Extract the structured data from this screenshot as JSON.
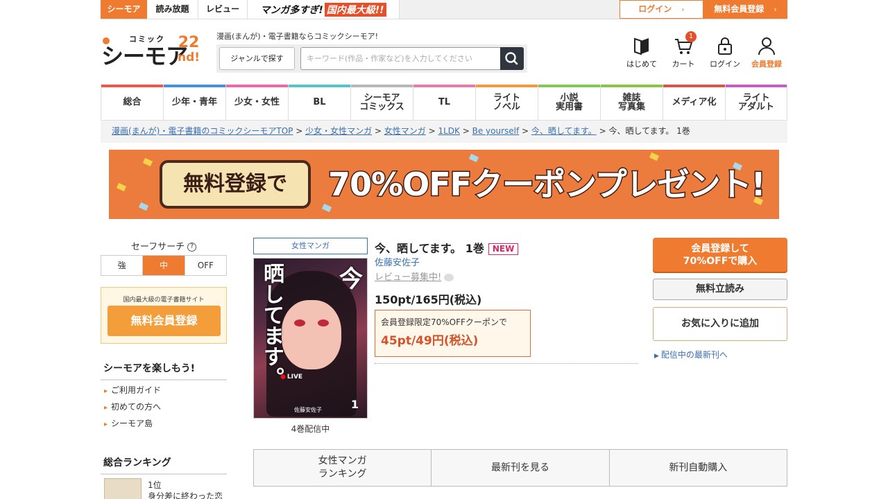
{
  "topbar": {
    "tabs": [
      "シーモア",
      "読み放題",
      "レビュー"
    ],
    "promo_a": "マンガ多すぎ!",
    "promo_b": "国内最大級!!",
    "login": "ログイン",
    "register": "無料会員登録"
  },
  "header": {
    "logo_small": "コミック",
    "logo_big": "シーモア",
    "logo_num": "22",
    "logo_nd": "nd!",
    "tagline": "漫画(まんが)・電子書籍ならコミックシーモア!",
    "genre_button": "ジャンルで探す",
    "search_placeholder": "キーワード(作品・作家など)を入力してください",
    "icons": [
      {
        "label": "はじめて",
        "icon": "book-icon"
      },
      {
        "label": "カート",
        "icon": "cart-icon",
        "badge": "1"
      },
      {
        "label": "ログイン",
        "icon": "lock-icon"
      },
      {
        "label": "会員登録",
        "icon": "user-icon"
      }
    ]
  },
  "gnav": {
    "items": [
      {
        "label": "総合",
        "color": "#e8594f"
      },
      {
        "label": "少年・青年",
        "color": "#4a90d9"
      },
      {
        "label": "少女・女性",
        "color": "#e86aa6"
      },
      {
        "label": "BL",
        "color": "#59c2c9"
      },
      {
        "label": "シーモア\nコミックス",
        "color": "#b7b7b7"
      },
      {
        "label": "TL",
        "color": "#e57cae"
      },
      {
        "label": "ライト\nノベル",
        "color": "#f39a3c"
      },
      {
        "label": "小説\n実用書",
        "color": "#86c55a"
      },
      {
        "label": "雑誌\n写真集",
        "color": "#8bc34a"
      },
      {
        "label": "メディア化",
        "color": "#d9534f"
      },
      {
        "label": "ライト\nアダルト",
        "color": "#c25fc7"
      }
    ]
  },
  "breadcrumb": {
    "items": [
      "漫画(まんが)・電子書籍のコミックシーモアTOP",
      "少女・女性マンガ",
      "女性マンガ",
      "1LDK",
      "Be yourself",
      "今、晒してます。"
    ],
    "current": "今、晒してます。 1巻"
  },
  "banner": {
    "left": "無料登録で",
    "right": "70%OFFクーポンプレゼント!"
  },
  "sidebar": {
    "safe_title": "セーフサーチ",
    "safe_help": "?",
    "safe_options": [
      "強",
      "中",
      "OFF"
    ],
    "safe_selected": "中",
    "reg_small": "国内最大級の電子書籍サイト",
    "reg_button": "無料会員登録",
    "enjoy_title": "シーモアを楽しもう!",
    "enjoy_links": [
      "ご利用ガイド",
      "初めての方へ",
      "シーモア島"
    ],
    "ranking_title": "総合ランキング",
    "rank_no": "1位",
    "rank_title": "身分差に終わった恋"
  },
  "product": {
    "genre": "女性マンガ",
    "title": "今、晒してます。 1巻",
    "new_badge": "NEW",
    "author": "佐藤安佐子",
    "review": "レビュー募集中!",
    "price": "150pt/165円(税込)",
    "coupon_note": "会員登録限定70%OFFクーポンで",
    "coupon_price": "45pt/49円(税込)",
    "available": "4巻配信中",
    "cover": {
      "title_a": "晒してます。",
      "title_b": "今",
      "live": "LIVE",
      "vol": "1",
      "author": "佐藤安佐子"
    }
  },
  "actions": {
    "buy": "会員登録して\n70%OFFで購入",
    "read": "無料立読み",
    "favorite": "お気に入りに追加",
    "latest": "配信中の最新刊へ"
  },
  "bottom_tabs": [
    "女性マンガ\nランキング",
    "最新刊を見る",
    "新刊自動購入"
  ]
}
